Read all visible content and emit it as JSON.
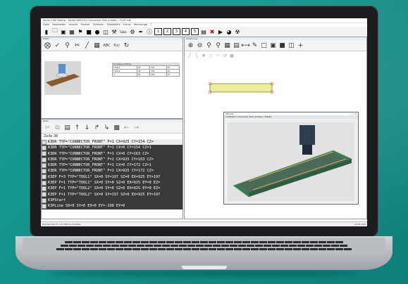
{
  "app": {
    "window_title": "Alpha CAM Tooling - Data\\CAM\\2021 Connector Post (model) - FLDT.cdb",
    "menu": [
      "Datei",
      "Bearbeiten",
      "Ansicht",
      "Fenster",
      "Optionen",
      "Objekthilfe",
      "Extras",
      "Werkzeuge",
      "?"
    ],
    "main_toolbar_label": "Sabc",
    "status_text": "Drücken Sie F1, um Hilfe zu erhalten",
    "status_right": "22.03.2021"
  },
  "left_top_pane": {
    "title": "Editor",
    "table_header": "3-D edge profiling",
    "rows": [
      {
        "name": "TOOL1",
        "a": "25",
        "b": "397",
        "c": "25"
      },
      {
        "name": "TOOL2",
        "a": "25",
        "b": "397",
        "c": "25"
      },
      {
        "name": "X",
        "a": "25",
        "b": "397",
        "c": "25"
      }
    ]
  },
  "left_bottom_pane": {
    "title": "Zeile",
    "line_label": "Zeile 36",
    "lines": [
      "K3DR TYP=\"CONNECTOR_FRONT\" F=1 CX=925 CY=154 CZ=",
      "K3DR TYP=\"CONNECTOR_FRONT\" F=1 CX=0 CY=154 CZ=1",
      "K3DR TYP=\"CONNECTOR_FRONT\" F=1 CX=0 CY=163 CZ=",
      "K3DR TYP=\"CONNECTOR_FRONT\" F=1 CX=925 CY=163 CZ=",
      "K3DR TYP=\"CONNECTOR_FRONT\" F=1 CX=0 CY=172 CZ=1",
      "K3DR TYP=\"CONNECTOR_FRONT\" F=1 CX=925 CY=172 CZ=",
      "K3EP F=3 TYP=\"TOOL1\" SX=0 SY=197 SZ=0 EX=925 EY=197",
      "K3EP F=1 TYP=\"TOOL1\" SX=0 SY=0 SZ=0 EX=925 EY=0 EZ=",
      "K3EP F=1 TYP=\"TOOL2\" SX=0 SY=0 SZ=0 EX=925 EY=0 EZ=",
      "K3EP F=1 TYP=\"TOOL2\" SX=0 SY=197 SZ=0 EX=925 EY=197",
      "K3PStart",
      "K3PLine SX=0 SY=0 EX=0 EY=-190 EY=0"
    ]
  },
  "right_pane": {
    "title": "Zeichnung",
    "view_window_title": "3DView",
    "view_toolbar_value": "1700/100 / Connector Post (model) / Stärke"
  }
}
